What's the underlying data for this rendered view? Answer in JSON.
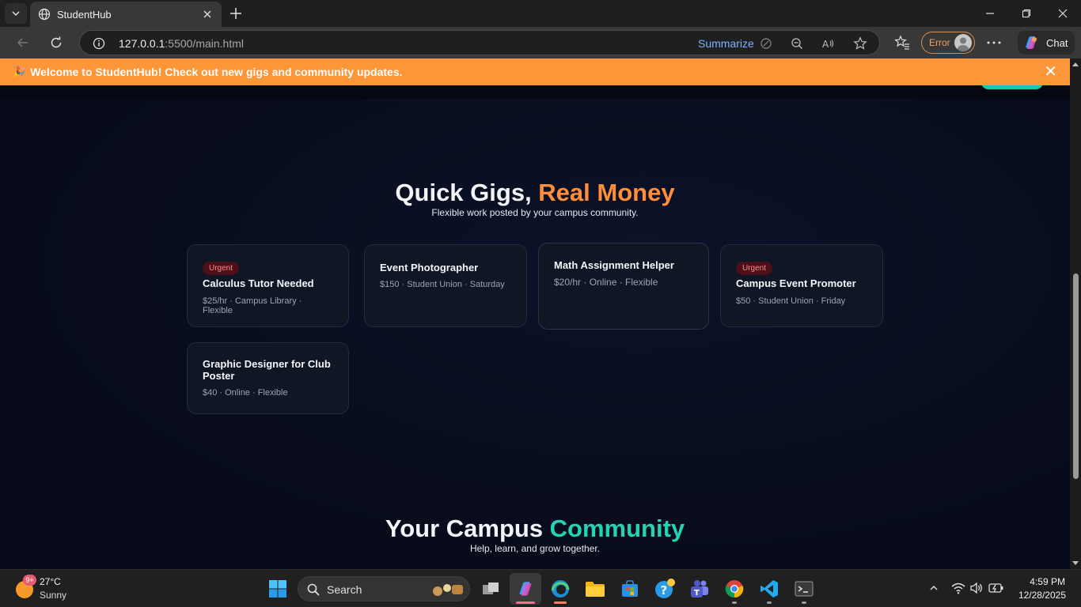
{
  "browser": {
    "tab_title": "StudentHub",
    "url_host": "127.0.0.1",
    "url_path": ":5500/main.html",
    "summarize_label": "Summarize",
    "profile_label": "Error",
    "chat_label": "Chat",
    "icons": [
      "tab-list-icon",
      "globe-icon",
      "close-icon",
      "plus-icon",
      "minimize-icon",
      "restore-icon",
      "back-icon",
      "refresh-icon",
      "info-icon",
      "zoom-out-icon",
      "read-aloud-icon",
      "star-icon",
      "favorites-icon",
      "more-icon",
      "copilot-icon"
    ]
  },
  "banner": {
    "emoji": "🎉",
    "text": "Welcome to StudentHub! Check out new gigs and community updates.",
    "close": "✕"
  },
  "gigs_section": {
    "title_main": "Quick Gigs, ",
    "title_accent": "Real Money",
    "subtitle": "Flexible work posted by your campus community.",
    "cards": [
      {
        "badge": "Urgent",
        "title": "Calculus Tutor Needed",
        "meta": "$25/hr · Campus Library · Flexible"
      },
      {
        "badge": "",
        "title": "Event Photographer",
        "meta": "$150 · Student Union · Saturday"
      },
      {
        "badge": "",
        "title": "Math Assignment Helper",
        "meta": "$20/hr · Online · Flexible"
      },
      {
        "badge": "Urgent",
        "title": "Campus Event Promoter",
        "meta": "$50 · Student Union · Friday"
      },
      {
        "badge": "",
        "title": "Graphic Designer for Club Poster",
        "meta": "$40 · Online · Flexible"
      }
    ]
  },
  "community_section": {
    "title_main": "Your Campus ",
    "title_accent": "Community",
    "subtitle": "Help, learn, and grow together."
  },
  "taskbar": {
    "weather_badge": "9+",
    "weather_temp": "27°C",
    "weather_desc": "Sunny",
    "search_label": "Search",
    "time": "4:59 PM",
    "date": "12/28/2025"
  },
  "colors": {
    "banner": "#fd9639",
    "accent_orange": "#fd8f3b",
    "accent_teal": "#22d3b6",
    "page_bg": "#070b1a"
  }
}
